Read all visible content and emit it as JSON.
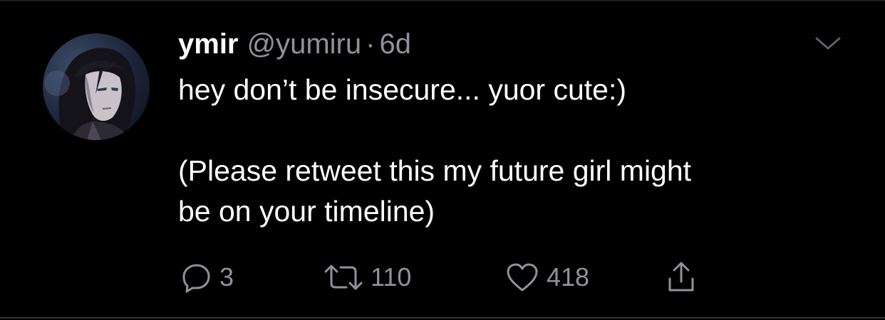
{
  "tweet": {
    "display_name": "ymir",
    "handle": "@yumiru",
    "separator": "·",
    "age": "6d",
    "text_line1": "hey don’t be insecure... yuor cute:)",
    "text_line2": "(Please retweet this my future girl might",
    "text_line3": "be on your timeline)"
  },
  "actions": {
    "reply": {
      "icon": "reply-icon",
      "count": "3"
    },
    "retweet": {
      "icon": "retweet-icon",
      "count": "110"
    },
    "like": {
      "icon": "heart-icon",
      "count": "418"
    },
    "share": {
      "icon": "share-icon"
    }
  },
  "menu": {
    "icon": "chevron-down-icon"
  },
  "colors": {
    "background": "#000000",
    "text": "#ffffff",
    "secondary_text": "#8e9399"
  }
}
